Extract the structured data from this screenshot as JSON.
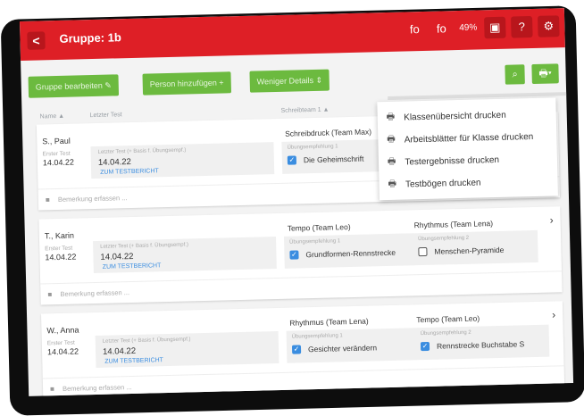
{
  "header": {
    "back_icon": "chevron-left-icon",
    "back_glyph": "<",
    "title": "Gruppe: 1b",
    "icon_a": "fo",
    "icon_b": "fo",
    "battery": "49%",
    "help": "?",
    "icon_c": "▣",
    "icon_d": "⚙"
  },
  "toolbar": {
    "edit_group": "Gruppe bearbeiten",
    "edit_icon": "✎",
    "add_person": "Person hinzufügen",
    "plus": "+",
    "less_details": "Weniger Details",
    "collapse_icon": "⇕",
    "search_icon": "⌕",
    "print_icon": "🖶",
    "caret": "▾"
  },
  "columns": {
    "name": "Name ▲",
    "last_test": "Letzter Test",
    "exercise": "Schreibteam 1 ▲"
  },
  "colors": {
    "red": "#de1f26",
    "green": "#6cba3f",
    "blue": "#3a8de0"
  },
  "rows": [
    {
      "name": "S., Paul",
      "first_label": "Erster Test",
      "first_date": "14.04.22",
      "last_label": "Letzter Test (+ Basis f. Übungsempf.)",
      "last_date": "14.04.22",
      "link": "ZUM TESTBERICHT",
      "ex1": {
        "title": "Schreibdruck (Team Max)",
        "label": "Übungsempfehlung 1",
        "item": "Die Geheimschrift",
        "checked": true
      }
    },
    {
      "name": "T., Karin",
      "first_label": "Erster Test",
      "first_date": "14.04.22",
      "last_label": "Letzter Test (+ Basis f. Übungsempf.)",
      "last_date": "14.04.22",
      "link": "ZUM TESTBERICHT",
      "ex1": {
        "title": "Tempo (Team Leo)",
        "label": "Übungsempfehlung 1",
        "item": "Grundformen-Rennstrecke",
        "checked": true
      },
      "ex2": {
        "title": "Rhythmus (Team Lena)",
        "label": "Übungsempfehlung 2",
        "item": "Menschen-Pyramide",
        "checked": false
      }
    },
    {
      "name": "W., Anna",
      "first_label": "Erster Test",
      "first_date": "14.04.22",
      "last_label": "Letzter Test (+ Basis f. Übungsempf.)",
      "last_date": "14.04.22",
      "link": "ZUM TESTBERICHT",
      "ex1": {
        "title": "Rhythmus (Team Lena)",
        "label": "Übungsempfehlung 1",
        "item": "Gesichter verändern",
        "checked": true
      },
      "ex2": {
        "title": "Tempo (Team Leo)",
        "label": "Übungsempfehlung 2",
        "item": "Rennstrecke Buchstabe S",
        "checked": true
      }
    }
  ],
  "remark": {
    "icon": "■",
    "text": "Bemerkung erfassen ..."
  },
  "chevron": "›",
  "check": "✓",
  "dropdown": [
    {
      "label": "Klassenübersicht drucken"
    },
    {
      "label": "Arbeitsblätter für Klasse drucken"
    },
    {
      "label": "Testergebnisse drucken"
    },
    {
      "label": "Testbögen drucken"
    }
  ]
}
